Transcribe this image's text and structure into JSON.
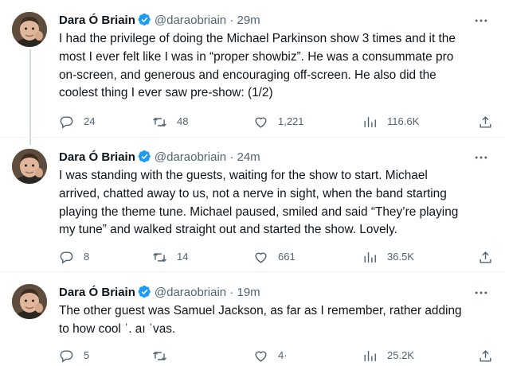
{
  "tweets": [
    {
      "name": "Dara Ó Briain",
      "handle": "@daraobriain",
      "separator": "·",
      "time": "29m",
      "text": "I had the privilege of doing the Michael Parkinson show 3 times and it the\nmost I ever felt like I was in “proper showbiz”. He was a consummate pro\non-screen, and generous and encouraging off-screen. He also did the\ncoolest thing I ever saw pre-show: (1/2)",
      "replies": "24",
      "retweets": "48",
      "likes": "1,221",
      "views": "116.6K"
    },
    {
      "name": "Dara Ó Briain",
      "handle": "@daraobriain",
      "separator": "·",
      "time": "24m",
      "text": "I was standing with the guests, waiting for the show to start. Michael\narrived, chatted away to us, not a nerve in sight, when the band starting\nplaying the theme tune. Michael paused, smiled and said “They’re playing\nmy tune” and walked straight out and started the show. Lovely.",
      "replies": "8",
      "retweets": "14",
      "likes": "661",
      "views": "36.5K"
    },
    {
      "name": "Dara Ó Briain",
      "handle": "@daraobriain",
      "separator": "·",
      "time": "19m",
      "text": "The other guest was Samuel Jackson, as far as I remember, rather adding\nto how cool ˈ. aı ˈvas.",
      "replies": "5",
      "retweets": "",
      "likes": "4·",
      "views": "25.2K"
    }
  ],
  "colors": {
    "text": "#0f1419",
    "secondary": "#536471",
    "verified": "#1d9bf0",
    "thread_line": "#cfd9de",
    "divider": "#eff3f4"
  },
  "icons": [
    "reply-icon",
    "retweet-icon",
    "like-icon",
    "views-icon",
    "share-icon",
    "more-icon",
    "verified-badge-icon"
  ]
}
